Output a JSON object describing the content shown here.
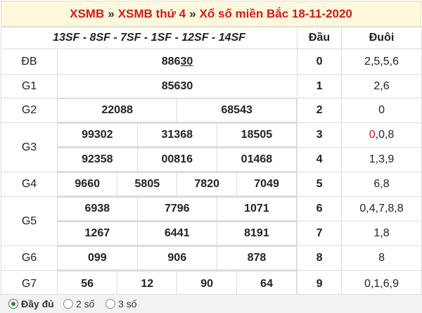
{
  "header": {
    "crumb1": "XSMB",
    "sep": "»",
    "crumb2": "XSMB thứ 4",
    "crumb3": "Xổ số miền Bắc 18-11-2020"
  },
  "table": {
    "codes": "13SF - 8SF - 7SF - 1SF - 12SF - 14SF",
    "col_dau": "Đầu",
    "col_duoi": "Đuôi"
  },
  "prizes": {
    "db": {
      "label": "ĐB",
      "value_prefix": "886",
      "value_suffix": "30"
    },
    "g1": {
      "label": "G1",
      "values": [
        "85630"
      ]
    },
    "g2": {
      "label": "G2",
      "values": [
        "22088",
        "68543"
      ]
    },
    "g3": {
      "label": "G3",
      "values": [
        "99302",
        "31368",
        "18505",
        "92358",
        "00816",
        "01468"
      ]
    },
    "g4": {
      "label": "G4",
      "values": [
        "9660",
        "5805",
        "7820",
        "7049"
      ]
    },
    "g5": {
      "label": "G5",
      "values": [
        "6938",
        "7796",
        "1071",
        "1267",
        "6441",
        "8191"
      ]
    },
    "g6": {
      "label": "G6",
      "values": [
        "099",
        "906",
        "878"
      ]
    },
    "g7": {
      "label": "G7",
      "values": [
        "56",
        "12",
        "90",
        "64"
      ]
    }
  },
  "loto": {
    "dau": [
      "0",
      "1",
      "2",
      "3",
      "4",
      "5",
      "6",
      "7",
      "8",
      "9"
    ],
    "duoi": [
      "2,5,5,6",
      "2,6",
      "0",
      ",0,8",
      "1,3,9",
      "6,8",
      "0,4,7,8,8",
      "1,8",
      "8",
      "0,1,6,9"
    ],
    "duoi3_first": "0"
  },
  "footer": {
    "options": [
      "Đầy đủ",
      "2 số",
      "3 số"
    ],
    "selected": "Đầy đủ"
  },
  "colors": {
    "accent_red": "#d21a1a",
    "code_blue": "#1a2fb0",
    "header_bg": "#fff8dc",
    "footer_bg": "#f2f2f2"
  }
}
